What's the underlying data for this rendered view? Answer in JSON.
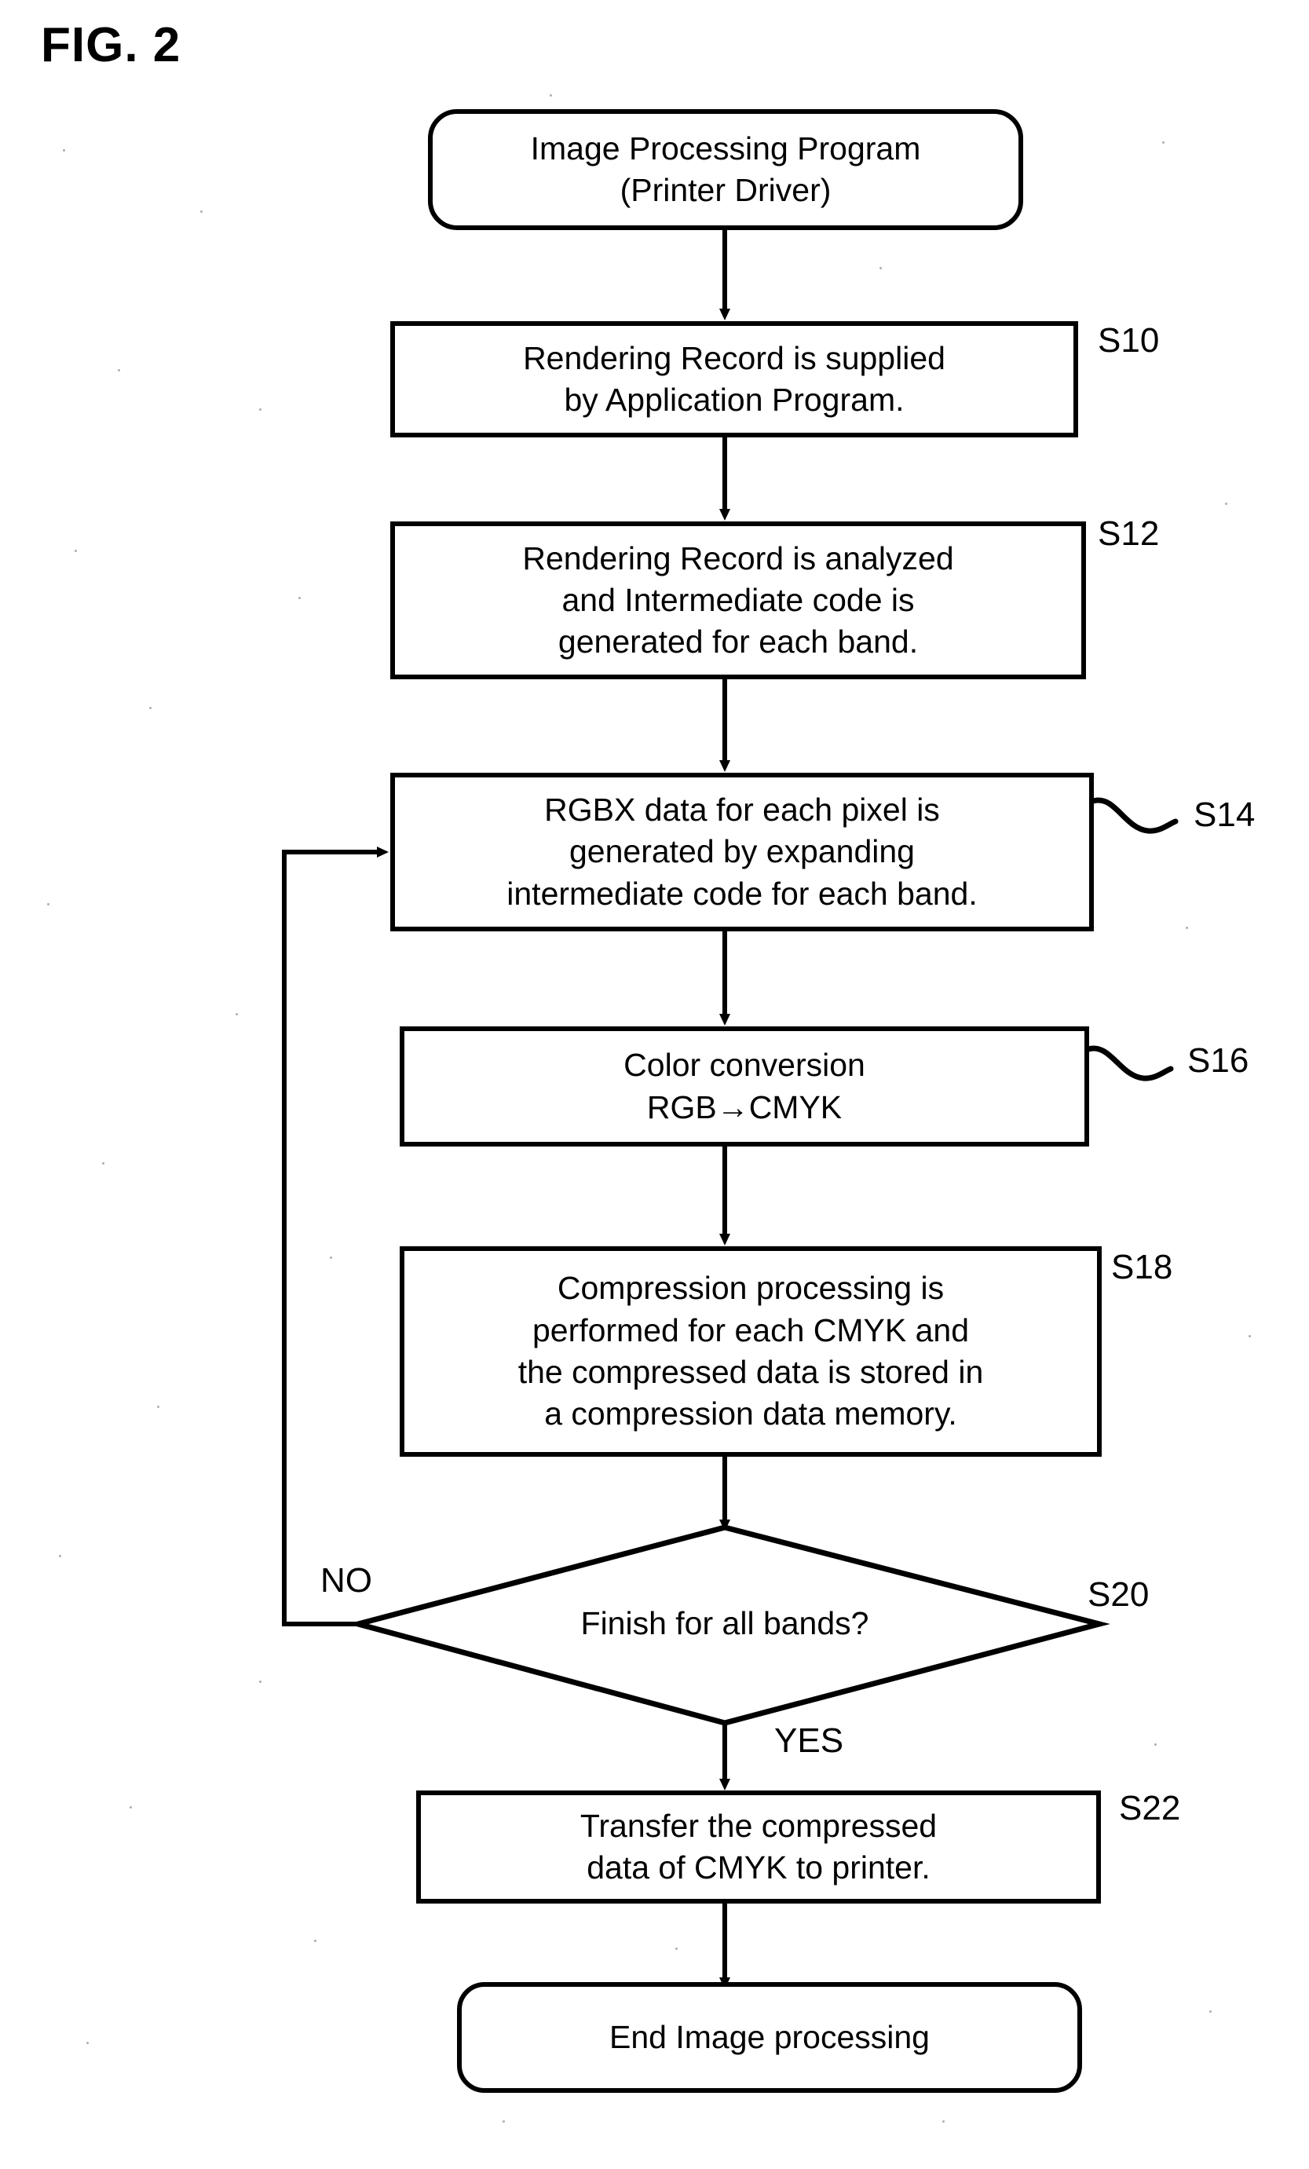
{
  "figure": {
    "title": "FIG. 2",
    "type": "flowchart",
    "line_color": "#000000",
    "background_color": "#ffffff"
  },
  "nodes": [
    {
      "id": "start",
      "shape": "rounded-rectangle",
      "lines": [
        "Image Processing Program",
        "(Printer Driver)"
      ],
      "step": ""
    },
    {
      "id": "s10",
      "shape": "rectangle",
      "lines": [
        "Rendering Record is supplied",
        "by Application Program."
      ],
      "step": "S10"
    },
    {
      "id": "s12",
      "shape": "rectangle",
      "lines": [
        "Rendering Record is analyzed",
        "and Intermediate code is",
        "generated for each band."
      ],
      "step": "S12"
    },
    {
      "id": "s14",
      "shape": "rectangle",
      "lines": [
        "RGBX data for each pixel is",
        "generated by expanding",
        "intermediate code for each band."
      ],
      "step": "S14"
    },
    {
      "id": "s16",
      "shape": "rectangle",
      "lines": [
        "Color conversion",
        "RGB→CMYK"
      ],
      "step": "S16"
    },
    {
      "id": "s18",
      "shape": "rectangle",
      "lines": [
        "Compression processing is",
        "performed for each CMYK and",
        "the compressed data is stored in",
        "a compression data memory."
      ],
      "step": "S18"
    },
    {
      "id": "s20",
      "shape": "diamond",
      "lines": [
        "Finish for all bands?"
      ],
      "step": "S20"
    },
    {
      "id": "s22",
      "shape": "rectangle",
      "lines": [
        "Transfer the compressed",
        "data of CMYK to printer."
      ],
      "step": "S22"
    },
    {
      "id": "end",
      "shape": "rounded-rectangle",
      "lines": [
        "End Image processing"
      ],
      "step": ""
    }
  ],
  "branches": {
    "no_label": "NO",
    "yes_label": "YES"
  },
  "edges": [
    {
      "from": "start",
      "to": "s10",
      "label": ""
    },
    {
      "from": "s10",
      "to": "s12",
      "label": ""
    },
    {
      "from": "s12",
      "to": "s14",
      "label": ""
    },
    {
      "from": "s14",
      "to": "s16",
      "label": ""
    },
    {
      "from": "s16",
      "to": "s18",
      "label": ""
    },
    {
      "from": "s18",
      "to": "s20",
      "label": ""
    },
    {
      "from": "s20",
      "to": "s14",
      "label": "NO"
    },
    {
      "from": "s20",
      "to": "s22",
      "label": "YES"
    },
    {
      "from": "s22",
      "to": "end",
      "label": ""
    }
  ]
}
